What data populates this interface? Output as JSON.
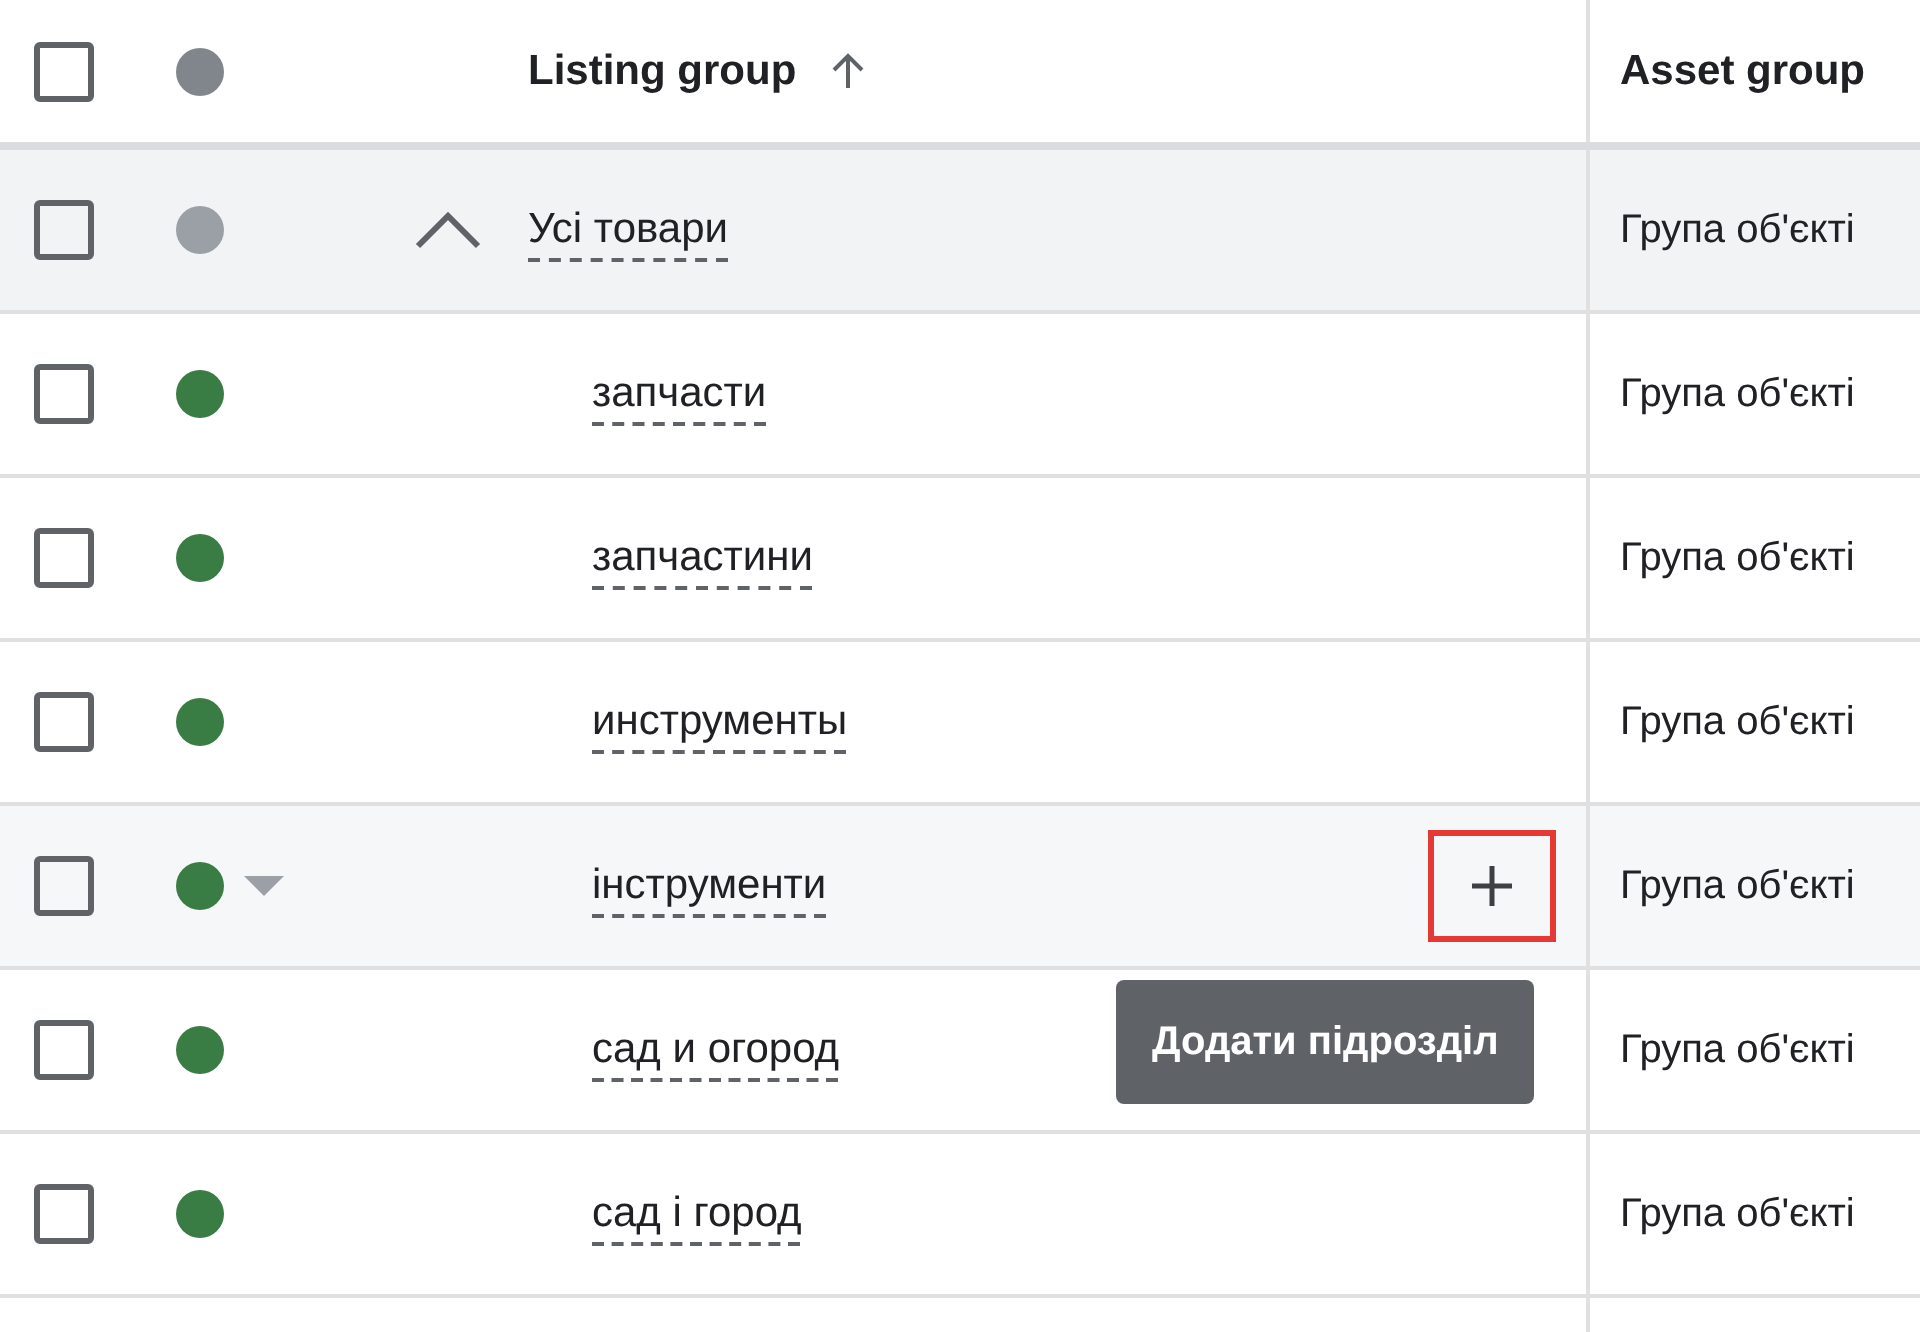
{
  "header": {
    "listing_group": "Listing group",
    "asset_group": "Asset group",
    "checked": false
  },
  "tree": [
    {
      "name": "Усі товари",
      "asset_group": "Група об'єкті",
      "checked": false,
      "color": "#9aa0a6",
      "expanded": true,
      "highlighted": false,
      "children": [
        {
          "name": "запчасти",
          "asset_group": "Група об'єкті",
          "checked": false,
          "color": "#3a7d44",
          "highlighted": false
        },
        {
          "name": "запчастини",
          "asset_group": "Група об'єкті",
          "checked": false,
          "color": "#3a7d44",
          "highlighted": false
        },
        {
          "name": "инструменты",
          "asset_group": "Група об'єкті",
          "checked": false,
          "color": "#3a7d44",
          "highlighted": false
        },
        {
          "name": "інструменти",
          "asset_group": "Група об'єкті",
          "checked": false,
          "color": "#3a7d44",
          "highlighted": true
        },
        {
          "name": "сад и огород",
          "asset_group": "Група об'єкті",
          "checked": false,
          "color": "#3a7d44",
          "highlighted": false
        },
        {
          "name": "сад і город",
          "asset_group": "Група об'єкті",
          "checked": false,
          "color": "#3a7d44",
          "highlighted": false
        }
      ]
    }
  ],
  "tooltip": {
    "text": "Додати підрозділ"
  }
}
